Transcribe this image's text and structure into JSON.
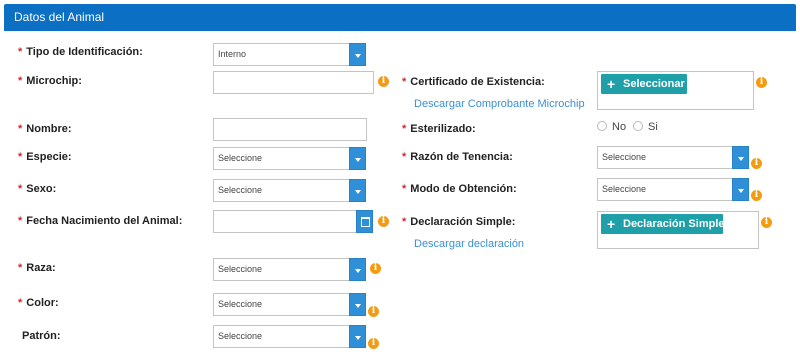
{
  "header": {
    "title": "Datos del Animal"
  },
  "form": {
    "tipo_id": {
      "label": "Tipo de Identificación:",
      "value": "Interno"
    },
    "microchip": {
      "label": "Microchip:",
      "value": ""
    },
    "certificado": {
      "label": "Certificado de Existencia:",
      "button": "Seleccionar",
      "link": "Descargar Comprobante Microchip"
    },
    "nombre": {
      "label": "Nombre:",
      "value": ""
    },
    "esterilizado": {
      "label": "Esterilizado:",
      "options": [
        "No",
        "Si"
      ]
    },
    "especie": {
      "label": "Especie:",
      "value": "Seleccione"
    },
    "razon_tenencia": {
      "label": "Razón de Tenencia:",
      "value": "Seleccione"
    },
    "sexo": {
      "label": "Sexo:",
      "value": "Seleccione"
    },
    "modo_obtencion": {
      "label": "Modo de Obtención:",
      "value": "Seleccione"
    },
    "fecha_nacimiento": {
      "label": "Fecha Nacimiento del Animal:",
      "value": ""
    },
    "declaracion": {
      "label": "Declaración Simple:",
      "button": "Declaración Simple",
      "link": "Descargar declaración"
    },
    "raza": {
      "label": "Raza:",
      "value": "Seleccione"
    },
    "color": {
      "label": "Color:",
      "value": "Seleccione"
    },
    "patron": {
      "label": "Patrón:",
      "value": "Seleccione"
    }
  },
  "required_marker": "*",
  "info_glyph": "i",
  "plus_glyph": "+",
  "colors": {
    "header": "#0b6fc4",
    "accent": "#2f90d8",
    "teal": "#1fa0a8",
    "info": "#f39c12",
    "required": "#cc2a2a",
    "link": "#3b8fd6"
  }
}
